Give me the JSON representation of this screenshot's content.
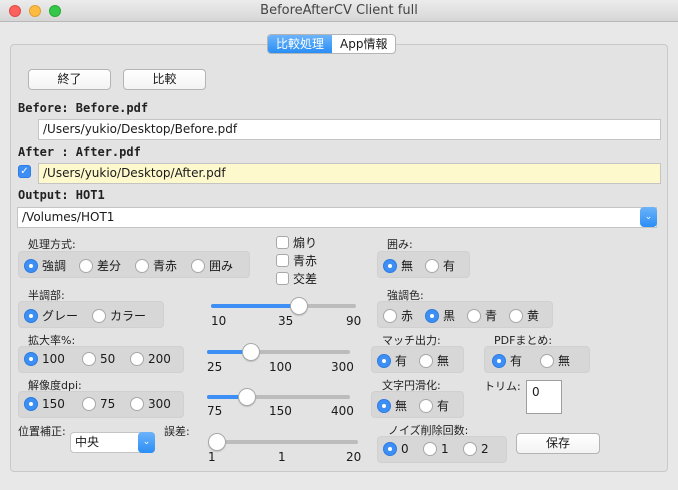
{
  "window": {
    "title": "BeforeAfterCV Client full"
  },
  "tabs": [
    {
      "label": "比較処理",
      "selected": true
    },
    {
      "label": "App情報",
      "selected": false
    }
  ],
  "buttons": {
    "quit": "終了",
    "compare": "比較",
    "save": "保存"
  },
  "before": {
    "label": "Before: Before.pdf",
    "path": "/Users/yukio/Desktop/Before.pdf"
  },
  "after": {
    "label": "After : After.pdf",
    "path": "/Users/yukio/Desktop/After.pdf",
    "checked": true
  },
  "output": {
    "label": "Output: HOT1",
    "path": "/Volumes/HOT1"
  },
  "processing": {
    "label": "処理方式:",
    "options": [
      "強調",
      "差分",
      "青赤",
      "囲み"
    ],
    "selected": 0
  },
  "checks": {
    "items": [
      "煽り",
      "青赤",
      "交差"
    ]
  },
  "enclose": {
    "label": "囲み:",
    "options": [
      "無",
      "有"
    ],
    "selected": 0
  },
  "halftone": {
    "label": "半調部:",
    "options": [
      "グレー",
      "カラー"
    ],
    "selected": 0
  },
  "slider1": {
    "min": "10",
    "mid": "35",
    "max": "90",
    "value": 0.62
  },
  "emphasis_color": {
    "label": "強調色:",
    "options": [
      "赤",
      "黒",
      "青",
      "黄"
    ],
    "selected": 1
  },
  "zoom": {
    "label": "拡大率%:",
    "options": [
      "100",
      "50",
      "200"
    ],
    "selected": 0
  },
  "slider2": {
    "min": "25",
    "mid": "100",
    "max": "300",
    "value": 0.28
  },
  "match_output": {
    "label": "マッチ出力:",
    "options": [
      "有",
      "無"
    ],
    "selected": 0
  },
  "pdf_merge": {
    "label": "PDFまとめ:",
    "options": [
      "有",
      "無"
    ],
    "selected": 0
  },
  "resolution": {
    "label": "解像度dpi:",
    "options": [
      "150",
      "75",
      "300"
    ],
    "selected": 0
  },
  "slider3": {
    "min": "75",
    "mid": "150",
    "max": "400",
    "value": 0.25
  },
  "smoothing": {
    "label": "文字円滑化:",
    "options": [
      "無",
      "有"
    ],
    "selected": 0
  },
  "trim": {
    "label": "トリム:",
    "value": "0"
  },
  "position": {
    "label": "位置補正:",
    "value": "中央"
  },
  "error": {
    "label": "誤差:"
  },
  "slider4": {
    "min": "1",
    "mid": "1",
    "max": "20",
    "value": 0.0
  },
  "noise": {
    "label": "ノイズ削除回数:",
    "options": [
      "0",
      "1",
      "2"
    ],
    "selected": 0
  },
  "colors": {
    "accent": "#3e8ff5",
    "yellow_field": "#fdf9cd"
  }
}
